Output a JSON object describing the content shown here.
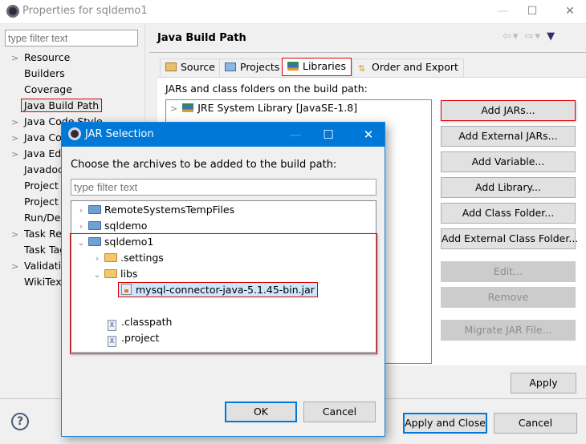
{
  "window": {
    "title": "Properties for sqldemo1",
    "minimize_label": "—",
    "maximize_label": "☐",
    "close_label": "✕"
  },
  "left": {
    "filter_placeholder": "type filter text",
    "items": [
      {
        "label": "Resource",
        "expandable": true
      },
      {
        "label": "Builders",
        "expandable": false
      },
      {
        "label": "Coverage",
        "expandable": false
      },
      {
        "label": "Java Build Path",
        "expandable": false,
        "selected": true
      },
      {
        "label": "Java Code Style",
        "expandable": true
      },
      {
        "label": "Java Compiler",
        "expandable": true
      },
      {
        "label": "Java Editor",
        "expandable": true
      },
      {
        "label": "Javadoc Location",
        "expandable": false
      },
      {
        "label": "Project Facets",
        "expandable": false
      },
      {
        "label": "Project References",
        "expandable": false
      },
      {
        "label": "Run/Debug Settings",
        "expandable": false
      },
      {
        "label": "Task Repository",
        "expandable": true
      },
      {
        "label": "Task Tags",
        "expandable": false
      },
      {
        "label": "Validation",
        "expandable": true
      },
      {
        "label": "WikiText",
        "expandable": false
      }
    ]
  },
  "page": {
    "title": "Java Build Path",
    "nav": {
      "back": "⇦",
      "back_menu": "▾",
      "forward": "⇨",
      "forward_menu": "▾",
      "view_menu": "▼"
    },
    "tabs": [
      {
        "label": "Source"
      },
      {
        "label": "Projects"
      },
      {
        "label": "Libraries",
        "active": true
      },
      {
        "label": "Order and Export"
      }
    ],
    "section_label": "JARs and class folders on the build path:",
    "libraries": [
      {
        "label": "JRE System Library [JavaSE-1.8]"
      }
    ],
    "buttons": {
      "add_jars": "Add JARs...",
      "add_external_jars": "Add External JARs...",
      "add_variable": "Add Variable...",
      "add_library": "Add Library...",
      "add_class_folder": "Add Class Folder...",
      "add_external_class_folder": "Add External Class Folder...",
      "edit": "Edit...",
      "remove": "Remove",
      "migrate_jar": "Migrate JAR File..."
    },
    "apply": "Apply"
  },
  "footer": {
    "help": "?",
    "apply_and_close": "Apply and Close",
    "cancel": "Cancel"
  },
  "dialog": {
    "title": "JAR Selection",
    "minimize_label": "—",
    "maximize_label": "☐",
    "close_label": "✕",
    "message": "Choose the archives to be added to the build path:",
    "filter_placeholder": "type filter text",
    "tree": [
      {
        "label": "RemoteSystemsTempFiles",
        "chev": "›"
      },
      {
        "label": "sqldemo",
        "chev": "›"
      },
      {
        "label": "sqldemo1",
        "chev": "⌄"
      },
      {
        "label": ".settings",
        "chev": "›"
      },
      {
        "label": "libs",
        "chev": "⌄"
      },
      {
        "label": "mysql-connector-java-5.1.45-bin.jar",
        "selected": true
      },
      {
        "label": ".classpath",
        "icon": "X"
      },
      {
        "label": ".project",
        "icon": "X"
      }
    ],
    "ok": "OK",
    "cancel": "Cancel"
  }
}
